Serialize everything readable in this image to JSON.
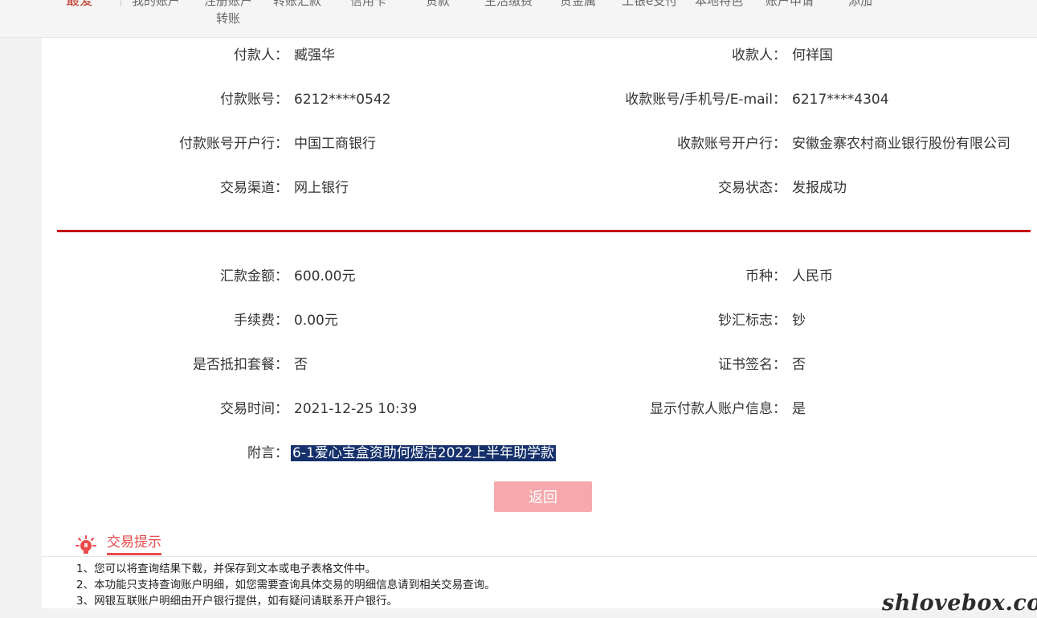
{
  "nav": {
    "items": [
      "最爱",
      "我的账户",
      "注册账户转账",
      "转账汇款",
      "信用卡",
      "贷款",
      "生活缴费",
      "贵金属",
      "工银e支付",
      "本地特色",
      "账户申请",
      "添加"
    ]
  },
  "details": {
    "payer_label": "付款人：",
    "payer": "臧强华",
    "payee_label": "收款人：",
    "payee": "何祥国",
    "payer_account_label": "付款账号：",
    "payer_account": "6212****0542",
    "payee_account_label": "收款账号/手机号/E-mail：",
    "payee_account": "6217****4304",
    "payer_bank_label": "付款账号开户行：",
    "payer_bank": "中国工商银行",
    "payee_bank_label": "收款账号开户行：",
    "payee_bank": "安徽金寨农村商业银行股份有限公司",
    "channel_label": "交易渠道：",
    "channel": "网上银行",
    "status_label": "交易状态：",
    "status": "发报成功",
    "amount_label": "汇款金额：",
    "amount": "600.00元",
    "currency_label": "币种：",
    "currency": "人民币",
    "fee_label": "手续费：",
    "fee": "0.00元",
    "cash_flag_label": "钞汇标志：",
    "cash_flag": "钞",
    "package_label": "是否抵扣套餐：",
    "package": "否",
    "cert_label": "证书签名：",
    "cert": "否",
    "time_label": "交易时间：",
    "time": "2021-12-25 10:39",
    "show_payer_label": "显示付款人账户信息：",
    "show_payer": "是",
    "remark_label": "附言：",
    "remark": "6-1爱心宝盒资助何煜洁2022上半年助学款"
  },
  "back_button": "返回",
  "tips": {
    "title": "交易提示",
    "lines": [
      "1、您可以将查询结果下载，并保存到文本或电子表格文件中。",
      "2、本功能只支持查询账户明细，如您需要查询具体交易的明细信息请到相关交易查询。",
      "3、网银互联账户明细由开户银行提供，如有疑问请联系开户银行。"
    ]
  },
  "watermark": "shlovebox.com",
  "colors": {
    "divider": "#c40000",
    "button": "#f6a8ad",
    "highlight": "#15306b",
    "tips_accent": "#e94b4b"
  }
}
